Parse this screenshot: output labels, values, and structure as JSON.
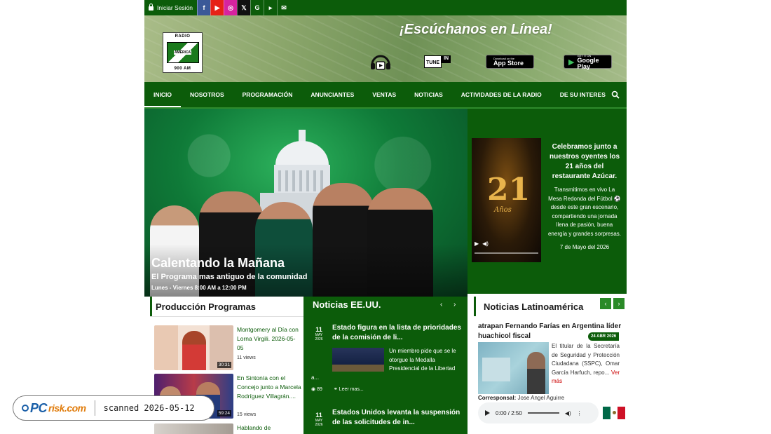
{
  "topbar": {
    "login_label": "Iniciar Sesión",
    "social": [
      {
        "icon": "facebook-icon",
        "glyph": "f",
        "color": "#3b5998"
      },
      {
        "icon": "youtube-icon",
        "glyph": "▶",
        "color": "#e62117"
      },
      {
        "icon": "instagram-icon",
        "glyph": "◎",
        "color": "#d6249f"
      },
      {
        "icon": "x-icon",
        "glyph": "𝕏",
        "color": "#111111"
      },
      {
        "icon": "google-icon",
        "glyph": "G",
        "color": "#0c5c0a"
      },
      {
        "icon": "google-play-icon",
        "glyph": "▸",
        "color": "#0c5c0a"
      },
      {
        "icon": "chat-icon",
        "glyph": "✉",
        "color": "#0c5c0a"
      }
    ]
  },
  "banner": {
    "slogan": "¡Escúchanos en Línea!",
    "logo_top": "RADIO",
    "logo_mid": "AMÉRICA",
    "logo_bottom": "900 AM",
    "tunein_left": "TUNE",
    "tunein_right": "IN",
    "appstore_small": "Download on the",
    "appstore_big": "App Store",
    "googleplay_small": "GET IT ON",
    "googleplay_big": "Google Play"
  },
  "nav": {
    "items": [
      "INICIO",
      "NOSOTROS",
      "PROGRAMACIÓN",
      "ANUNCIANTES",
      "VENTAS",
      "NOTICIAS",
      "ACTIVIDADES DE LA RADIO",
      "DE SU INTERES"
    ]
  },
  "hero": {
    "title": "Calentando la Mañana",
    "subtitle": "El Programa mas antiguo de la comunidad",
    "schedule": "Lunes - Viernes 8:00 AM a 12:00 PM"
  },
  "promo": {
    "poster_number": "21",
    "poster_word": "Años",
    "heading": "Celebramos junto a nuestros oyentes los 21 años del restaurante Azúcar.",
    "body": "Transmitimos en vivo La Mesa Redonda del Fútbol ⚽ desde este gran escenario, compartiendo una jornada llena de pasión, buena energía y grandes sorpresas.",
    "date": "7 de Mayo del 2026"
  },
  "produccion": {
    "heading": "Producción Programas",
    "videos": [
      {
        "title": "Montgomery al Día con Lorna Virgili. 2026-05-05",
        "views": "11 views",
        "duration": "30:31"
      },
      {
        "title": "En Sintonía con el Concejo junto a Marcela Rodríguez Villagrán....",
        "views": "15 views",
        "duration": "59:24"
      },
      {
        "title": "Hablando de",
        "views": "",
        "duration": ""
      }
    ]
  },
  "noticias_eeuu": {
    "heading": "Noticias EE.UU.",
    "items": [
      {
        "day": "11",
        "month": "MAY",
        "year": "2026",
        "title": "Estado figura en la lista de prioridades de la comisión de li...",
        "text": "Un miembro pide que se le otorgue la Medalla Presidencial de la Libertad",
        "ellipsis": "a...",
        "views": "89",
        "read_more": "Leer mas..."
      },
      {
        "day": "11",
        "month": "MAY",
        "year": "2026",
        "title": "Estados Unidos levanta la suspensión de las solicitudes de in..."
      }
    ]
  },
  "noticias_latam": {
    "heading": "Noticias Latinoamérica",
    "title": "atrapan Fernando Farías en Argentina líder huachicol fiscal",
    "badge": "24 ABR 2026",
    "text": "El titular de la Secretaría de Seguridad y Protección Ciudadana (SSPC), Omar García Harfuch, repo...",
    "more": "Ver más",
    "corr_label": "Corresponsal:",
    "corr_name": "Jose Angel Aguirre",
    "audio_time": "0:00 / 2:50"
  },
  "watermark": {
    "brand_pc": "PC",
    "brand_risk": "risk.com",
    "scan": "scanned 2026-05-12"
  },
  "colors": {
    "brand_green": "#0c5c0a",
    "accent_green": "#2a8a27",
    "link_red": "#cc0000"
  }
}
